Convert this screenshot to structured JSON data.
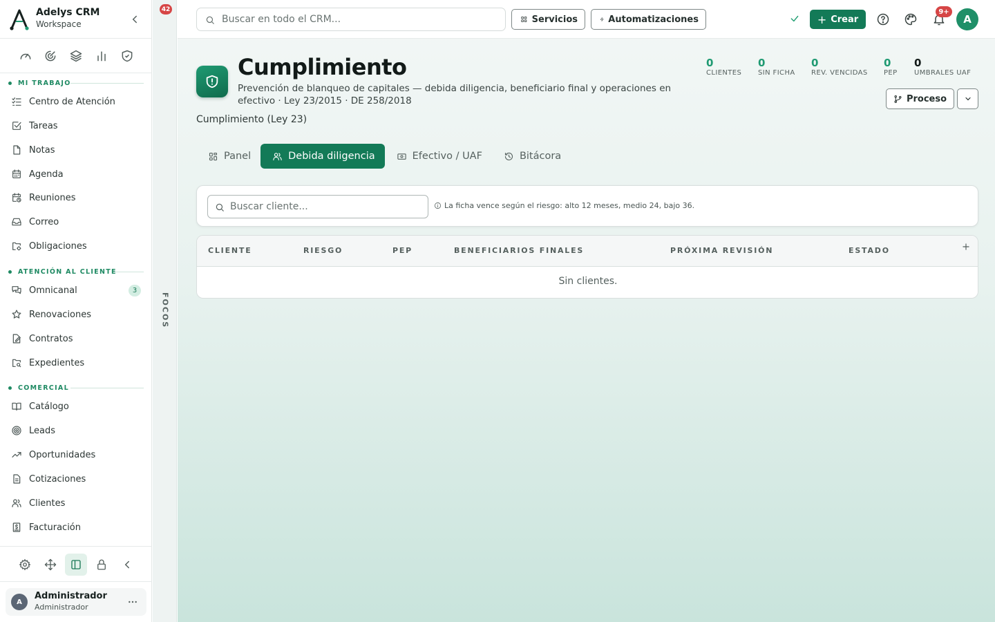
{
  "brand": {
    "name": "Adelys CRM",
    "subtitle": "Workspace"
  },
  "quick_icons": [
    "gauge-icon",
    "refresh-target-icon",
    "layers-icon",
    "bar-chart-icon",
    "shield-check-icon"
  ],
  "sections": {
    "mi_trabajo": "MI TRABAJO",
    "atencion": "ATENCIÓN AL CLIENTE",
    "comercial": "COMERCIAL"
  },
  "nav": {
    "mi_trabajo": [
      {
        "label": "Centro de Atención",
        "icon": "list-check-icon"
      },
      {
        "label": "Tareas",
        "icon": "checkbox-icon"
      },
      {
        "label": "Notas",
        "icon": "note-icon"
      },
      {
        "label": "Agenda",
        "icon": "calendar-icon"
      },
      {
        "label": "Reuniones",
        "icon": "calendar-clock-icon"
      },
      {
        "label": "Correo",
        "icon": "inbox-icon"
      },
      {
        "label": "Obligaciones",
        "icon": "folder-settings-icon"
      }
    ],
    "atencion": [
      {
        "label": "Omnicanal",
        "icon": "chat-icon",
        "badge": "3"
      },
      {
        "label": "Renovaciones",
        "icon": "star-icon"
      },
      {
        "label": "Contratos",
        "icon": "contract-icon"
      },
      {
        "label": "Expedientes",
        "icon": "folder-search-icon"
      }
    ],
    "comercial": [
      {
        "label": "Catálogo",
        "icon": "book-icon"
      },
      {
        "label": "Leads",
        "icon": "target-icon"
      },
      {
        "label": "Oportunidades",
        "icon": "trend-icon"
      },
      {
        "label": "Cotizaciones",
        "icon": "document-icon"
      },
      {
        "label": "Clientes",
        "icon": "users-icon"
      },
      {
        "label": "Facturación",
        "icon": "invoice-icon"
      }
    ]
  },
  "user": {
    "initial": "A",
    "name": "Administrador",
    "role": "Administrador"
  },
  "focus": {
    "badge": "42",
    "label": "FOCOS"
  },
  "topbar": {
    "search_placeholder": "Buscar en todo el CRM...",
    "servicios": "Servicios",
    "automatizaciones": "Automatizaciones",
    "crear": "Crear",
    "notif_badge": "9+",
    "avatar": "A"
  },
  "page": {
    "title": "Cumplimiento",
    "description": "Prevención de blanqueo de capitales — debida diligencia, beneficiario final y operaciones en efectivo · Ley 23/2015 · DE 258/2018",
    "crumb": "Cumplimiento (Ley 23)",
    "proceso": "Proceso"
  },
  "stats": [
    {
      "value": "0",
      "label": "CLIENTES"
    },
    {
      "value": "0",
      "label": "SIN FICHA"
    },
    {
      "value": "0",
      "label": "REV. VENCIDAS"
    },
    {
      "value": "0",
      "label": "PEP"
    },
    {
      "value": "0",
      "label": "UMBRALES UAF"
    }
  ],
  "tabs": [
    {
      "label": "Panel"
    },
    {
      "label": "Debida diligencia",
      "active": true
    },
    {
      "label": "Efectivo / UAF"
    },
    {
      "label": "Bitácora"
    }
  ],
  "filter": {
    "placeholder": "Buscar cliente...",
    "hint": "La ficha vence según el riesgo: alto 12 meses, medio 24, bajo 36."
  },
  "table": {
    "columns": [
      "CLIENTE",
      "RIESGO",
      "PEP",
      "BENEFICIARIOS FINALES",
      "PRÓXIMA REVISIÓN",
      "ESTADO"
    ],
    "empty": "Sin clientes."
  },
  "colors": {
    "accent": "#137a57",
    "accent_light": "#1f9a72",
    "notification": "#d64545"
  }
}
